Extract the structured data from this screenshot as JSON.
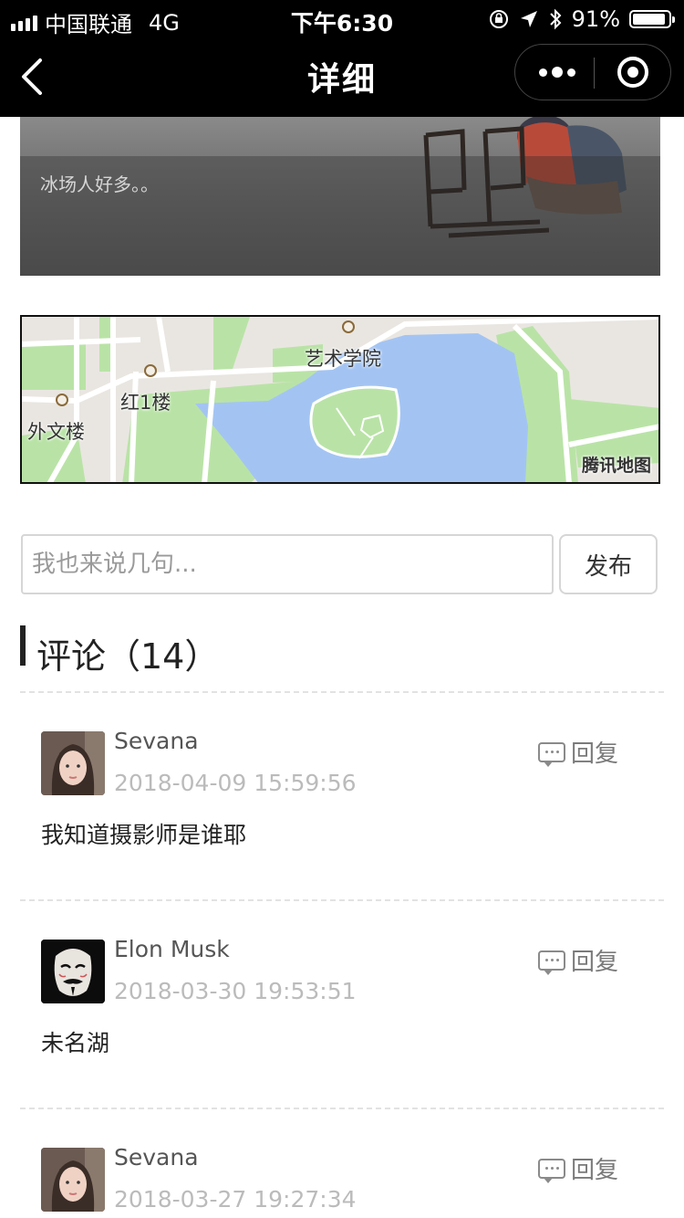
{
  "status_bar": {
    "carrier": "中国联通",
    "network": "4G",
    "time": "下午6:30",
    "battery": "91%",
    "battery_level": 0.91,
    "icons": [
      "signal-icon",
      "lock-rotation-icon",
      "location-arrow-icon",
      "bluetooth-icon",
      "battery-icon"
    ]
  },
  "nav": {
    "title": "详细",
    "back_icon": "chevron-left-icon",
    "menu_icon": "more-dots-icon",
    "close_icon": "target-icon"
  },
  "photo": {
    "caption": "冰场人好多。。"
  },
  "map": {
    "labels": [
      "艺术学院",
      "红1楼",
      "外文楼"
    ],
    "provider": "腾讯地图",
    "colors": {
      "water": "#a3c4f3",
      "green": "#b9e3a6",
      "land": "#e9e6e1",
      "road": "#ffffff"
    }
  },
  "comment_form": {
    "placeholder": "我也来说几句...",
    "value": "",
    "submit_label": "发布"
  },
  "comments_section": {
    "title": "评论（14）",
    "reply_label": "回复",
    "items": [
      {
        "name": "Sevana",
        "date": "2018-04-09 15:59:56",
        "text": "我知道摄影师是谁耶",
        "avatar": "girl"
      },
      {
        "name": "Elon Musk",
        "date": "2018-03-30 19:53:51",
        "text": "未名湖",
        "avatar": "mask"
      },
      {
        "name": "Sevana",
        "date": "2018-03-27 19:27:34",
        "text": "",
        "avatar": "girl"
      }
    ]
  }
}
